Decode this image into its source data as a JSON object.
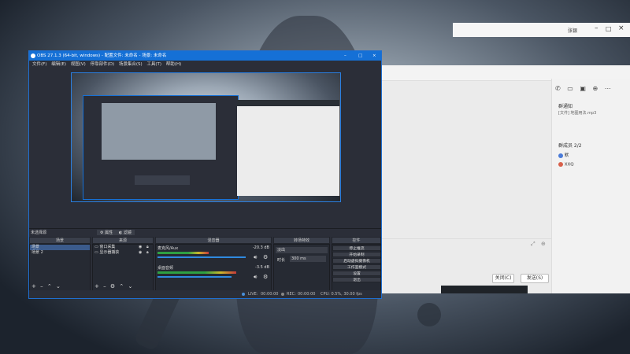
{
  "obs": {
    "title": "OBS 27.1.3 (64-bit, windows) - 配置文件: 未命名 - 场景: 未命名",
    "menu": [
      "文件(F)",
      "编辑(E)",
      "视图(V)",
      "停靠部件(D)",
      "场景集合(S)",
      "工具(T)",
      "帮助(H)"
    ],
    "no_source_selected": "未选择源",
    "properties_label": "属性",
    "filters_label": "滤镜",
    "scenes": {
      "title": "场景",
      "items": [
        "场景",
        "场景 2"
      ]
    },
    "sources": {
      "title": "来源",
      "items": [
        "窗口采集",
        "显示器捕获"
      ]
    },
    "mixer": {
      "title": "混音器",
      "channels": [
        {
          "name": "麦克风/Aux",
          "db": "-20.3 dB",
          "level": 0.55,
          "volume": 0.95
        },
        {
          "name": "桌面音频",
          "db": "-3.5 dB",
          "level": 0.85,
          "volume": 0.8
        }
      ]
    },
    "transitions": {
      "title": "转场特效",
      "type": "淡出",
      "duration_label": "时长",
      "duration": "300 ms"
    },
    "controls": {
      "title": "控件",
      "buttons": [
        "停止推流",
        "开始录制",
        "启动虚拟摄像机",
        "工作室模式",
        "设置",
        "退出"
      ]
    },
    "status": {
      "live_label": "LIVE:",
      "live_time": "00:00:00",
      "rec_label": "REC:",
      "rec_time": "00:00:00",
      "cpu": "CPU: 0.5%, 30.00 fps"
    },
    "colors": {
      "accent": "#1570d6",
      "panel": "#2b2e38"
    }
  },
  "chat": {
    "title": "张银",
    "group_notice_label": "群通知",
    "group_notice_text": "[文件] 地图用法.mp3",
    "members_title": "群成员 2/2",
    "members": [
      "默",
      "XXQ"
    ],
    "close_button": "关闭(C)",
    "send_button": "发送(S)"
  }
}
